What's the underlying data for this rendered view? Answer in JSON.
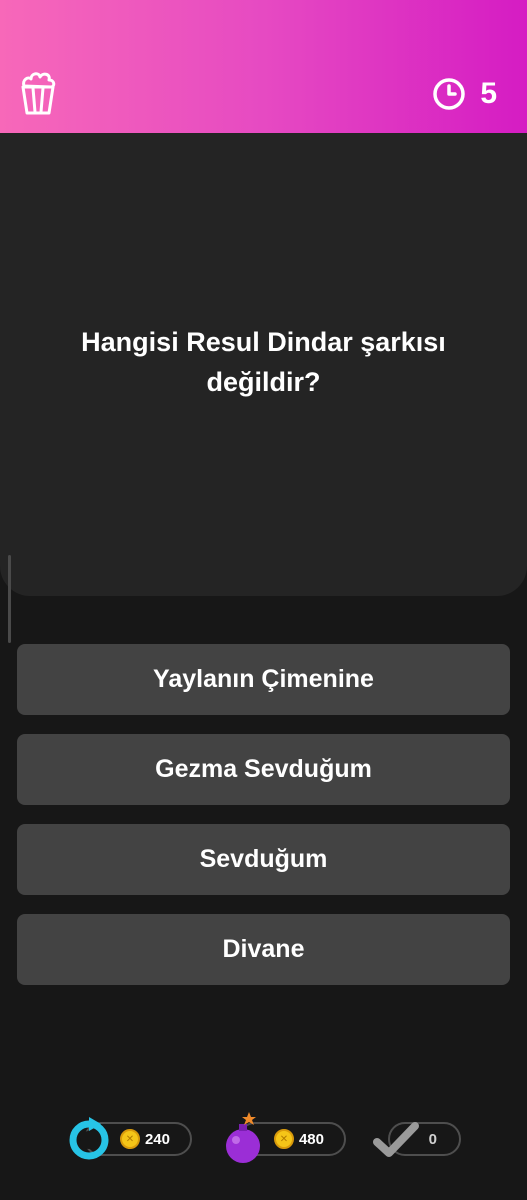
{
  "header": {
    "timer_value": "5",
    "gradient_colors": [
      "#f768b9",
      "#d51cc3"
    ]
  },
  "question": {
    "text": "Hangisi Resul Dindar şarkısı değildir?"
  },
  "answers": [
    {
      "label": "Yaylanın Çimenine"
    },
    {
      "label": "Gezma Sevduğum"
    },
    {
      "label": "Sevduğum"
    },
    {
      "label": "Divane"
    }
  ],
  "powerups": [
    {
      "icon": "refresh-icon",
      "cost": "240",
      "color": "#27c4e6"
    },
    {
      "icon": "bomb-icon",
      "cost": "480",
      "color": "#9b2ed6"
    },
    {
      "icon": "check-icon",
      "count": "0",
      "color": "#9a9a9a"
    }
  ]
}
